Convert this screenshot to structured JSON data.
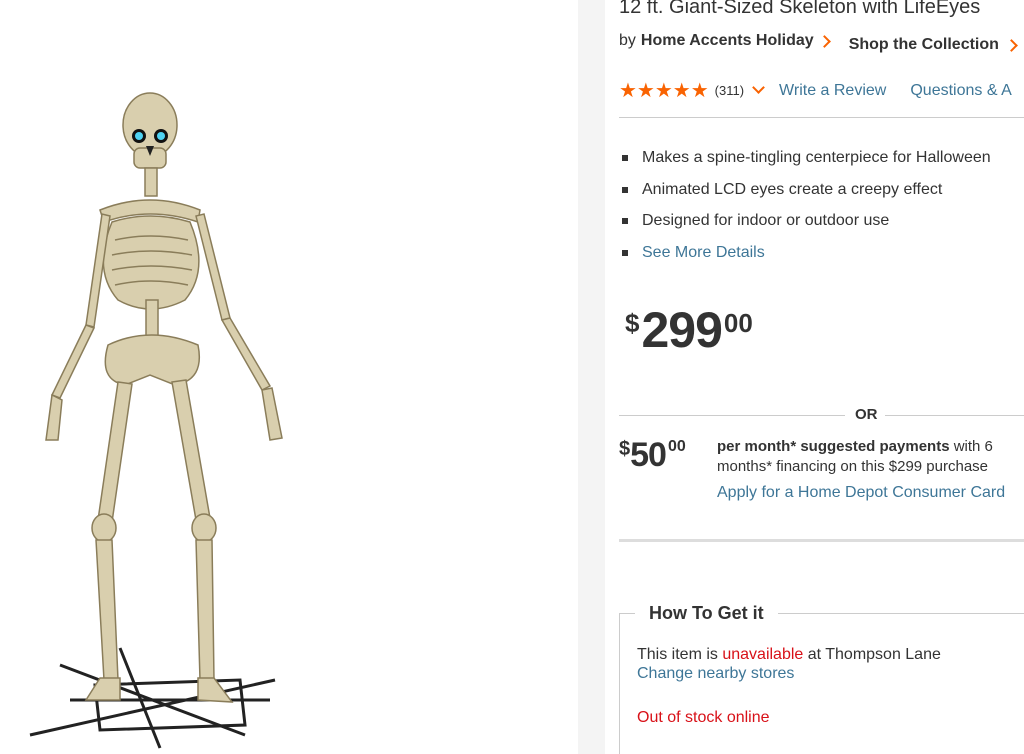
{
  "product": {
    "title": "12 ft. Giant-Sized Skeleton with LifeEyes",
    "by_label": "by",
    "brand": "Home Accents Holiday",
    "collection_link": "Shop the Collection",
    "image_alt_icon": "skeleton-product-image"
  },
  "rating": {
    "stars": "★★★★★",
    "count": "(311)",
    "write_review": "Write a Review",
    "questions": "Questions & A"
  },
  "highlights": [
    "Makes a spine-tingling centerpiece for Halloween",
    "Animated LCD eyes create a creepy effect",
    "Designed for indoor or outdoor use",
    "See More Details"
  ],
  "price": {
    "currency": "$",
    "dollars": "299",
    "cents": "00"
  },
  "financing": {
    "or_label": "OR",
    "currency": "$",
    "dollars": "50",
    "cents": "00",
    "line1_bold": "per month* suggested payments",
    "line1_rest": " with 6",
    "line2": "months* financing on this $299 purchase",
    "apply_link": "Apply for a Home Depot Consumer Card"
  },
  "fulfillment": {
    "heading": "How To Get it",
    "avail_prefix": "This item is ",
    "avail_status": "unavailable",
    "avail_suffix": " at Thompson Lane",
    "change_stores": "Change nearby stores",
    "online_status": "Out of stock online"
  },
  "colors": {
    "accent": "#f96302",
    "link": "#3e7697",
    "alert": "#d81118"
  }
}
